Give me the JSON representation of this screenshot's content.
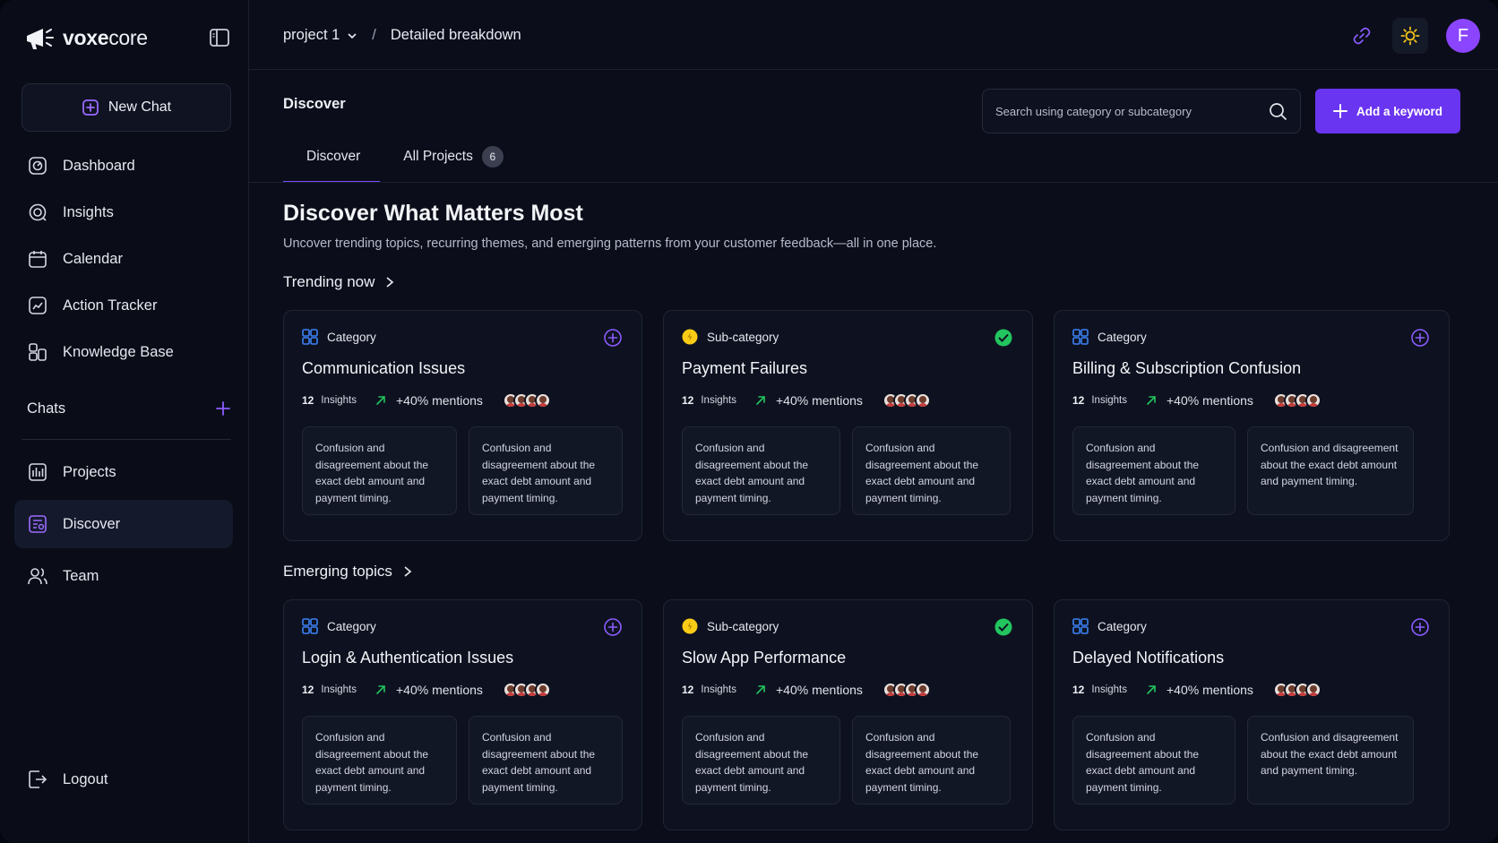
{
  "brand": {
    "name_prefix": "voxe",
    "name_suffix": "core"
  },
  "header": {
    "project": "project 1",
    "separator": "/",
    "page": "Detailed breakdown",
    "avatar_initial": "F"
  },
  "sidebar": {
    "new_chat": "New Chat",
    "items": [
      {
        "label": "Dashboard",
        "icon": "dashboard-icon"
      },
      {
        "label": "Insights",
        "icon": "insights-icon"
      },
      {
        "label": "Calendar",
        "icon": "calendar-icon"
      },
      {
        "label": "Action Tracker",
        "icon": "action-tracker-icon"
      },
      {
        "label": "Knowledge Base",
        "icon": "knowledge-base-icon"
      }
    ],
    "chats_label": "Chats",
    "items2": [
      {
        "label": "Projects",
        "icon": "projects-icon"
      },
      {
        "label": "Discover",
        "icon": "discover-icon",
        "active": true
      },
      {
        "label": "Team",
        "icon": "team-icon"
      }
    ],
    "logout": "Logout"
  },
  "page": {
    "heading": "Discover",
    "search_placeholder": "Search using category or subcategory",
    "add_keyword": "Add a keyword",
    "tabs": [
      {
        "label": "Discover",
        "active": true
      },
      {
        "label": "All Projects",
        "badge": "6"
      }
    ],
    "hero_title": "Discover What Matters Most",
    "hero_subtitle": "Uncover trending topics, recurring themes, and emerging patterns from your customer feedback—all in one place."
  },
  "sections": [
    {
      "title": "Trending now",
      "cards": [
        {
          "type": "Category",
          "title": "Communication Issues",
          "insights_count": "12",
          "insights_label": "Insights",
          "mentions": "+40% mentions",
          "action": "add",
          "snippets": [
            "Confusion and disagreement about the exact debt amount and payment timing.",
            "Confusion and disagreement about the exact debt amount and payment timing."
          ]
        },
        {
          "type": "Sub-category",
          "title": "Payment Failures",
          "insights_count": "12",
          "insights_label": "Insights",
          "mentions": "+40% mentions",
          "action": "added",
          "snippets": [
            "Confusion and disagreement about the exact debt amount and payment timing.",
            "Confusion and disagreement about the exact debt amount and payment timing."
          ]
        },
        {
          "type": "Category",
          "title": "Billing & Subscription Confusion",
          "insights_count": "12",
          "insights_label": "Insights",
          "mentions": "+40% mentions",
          "action": "add",
          "snippets": [
            "Confusion and disagreement about the exact debt amount and payment timing.",
            "Confusion and disagreement about the exact debt amount and payment timing."
          ]
        }
      ]
    },
    {
      "title": "Emerging topics",
      "cards": [
        {
          "type": "Category",
          "title": "Login & Authentication Issues",
          "insights_count": "12",
          "insights_label": "Insights",
          "mentions": "+40% mentions",
          "action": "add",
          "snippets": [
            "Confusion and disagreement about the exact debt amount and payment timing.",
            "Confusion and disagreement about the exact debt amount and payment timing."
          ]
        },
        {
          "type": "Sub-category",
          "title": "Slow App Performance",
          "insights_count": "12",
          "insights_label": "Insights",
          "mentions": "+40% mentions",
          "action": "added",
          "snippets": [
            "Confusion and disagreement about the exact debt amount and payment timing.",
            "Confusion and disagreement about the exact debt amount and payment timing."
          ]
        },
        {
          "type": "Category",
          "title": "Delayed Notifications",
          "insights_count": "12",
          "insights_label": "Insights",
          "mentions": "+40% mentions",
          "action": "add",
          "snippets": [
            "Confusion and disagreement about the exact debt amount and payment timing.",
            "Confusion and disagreement about the exact debt amount and payment timing."
          ]
        }
      ]
    }
  ],
  "colors": {
    "accent": "#6a35f0",
    "category_icon": "#3b82f6",
    "subcategory_dot": "#facc15",
    "added_check": "#22c55e",
    "trend_arrow": "#22c55e"
  }
}
